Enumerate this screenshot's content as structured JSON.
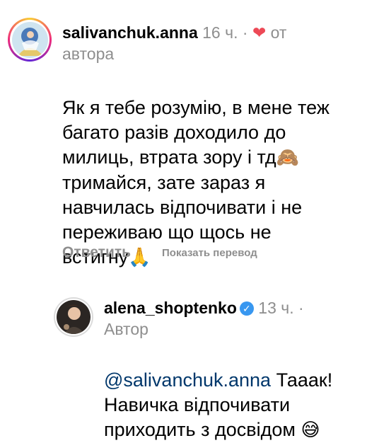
{
  "comment": {
    "username": "salivanchuk.anna",
    "time": "16 ч.",
    "separator": "·",
    "liked_by_author_icon": "heart-icon",
    "liked_by_author_label": "от",
    "liked_by_author_label_2": "автора",
    "text": "Як я тебе розумію, в мене теж\nбагато разів доходило до\nмилиць, втрата зору і тд",
    "emoji_1": "🙈",
    "text_2": "\nтримайся, зате зараз я\nнавчилась відпочивати і не\nпереживаю що щось не\nвстигну",
    "emoji_2": "🙏",
    "reply_label": "Ответить",
    "translate_label": "Показать перевод",
    "colors": {
      "accent_heart": "#ed4956",
      "secondary": "#8e8e8e"
    }
  },
  "reply": {
    "username": "alena_shoptenko",
    "verified_icon": "verified-badge-icon",
    "time": "13 ч.",
    "separator": "·",
    "author_label": "Автор",
    "mention": "@salivanchuk.anna",
    "text": " Тааак!\nНавичка відпочивати\nприходить з досвідом ",
    "emoji": "😅",
    "colors": {
      "mention": "#00376b",
      "verified": "#3897f0"
    }
  }
}
